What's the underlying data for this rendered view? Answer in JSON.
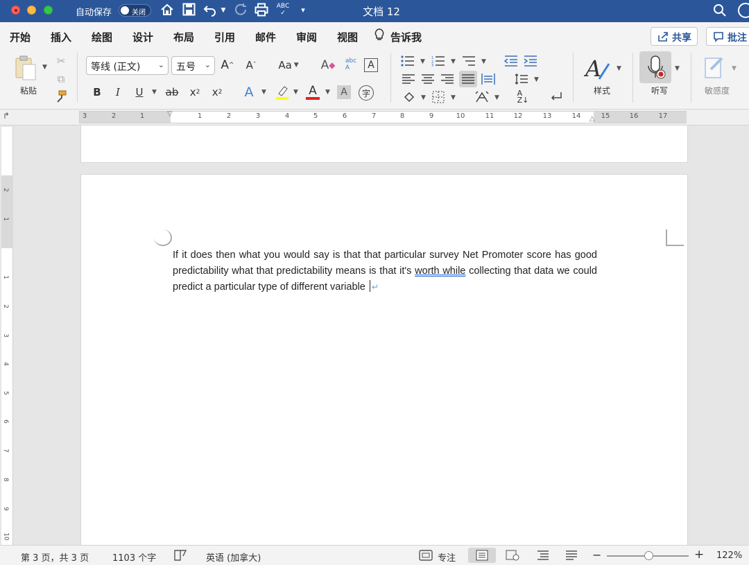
{
  "titlebar": {
    "autosave_label": "自动保存",
    "autosave_state": "关闭",
    "document_title": "文档 12"
  },
  "tabs": [
    {
      "label": "开始",
      "active": true
    },
    {
      "label": "插入"
    },
    {
      "label": "绘图"
    },
    {
      "label": "设计"
    },
    {
      "label": "布局"
    },
    {
      "label": "引用"
    },
    {
      "label": "邮件"
    },
    {
      "label": "审阅"
    },
    {
      "label": "视图"
    },
    {
      "label": "告诉我"
    }
  ],
  "header_buttons": {
    "share": "共享",
    "comments": "批注"
  },
  "ribbon": {
    "paste_label": "粘贴",
    "font_name": "等线 (正文)",
    "font_size": "五号",
    "change_case": "Aa",
    "styles_label": "样式",
    "dictate_label": "听写",
    "sensitivity_label": "敏感度",
    "bold": "B",
    "italic": "I",
    "underline": "U",
    "strikethrough": "ab",
    "subscript": "x",
    "superscript": "x"
  },
  "ruler": {
    "ticks": [
      "3",
      "2",
      "1",
      "1",
      "2",
      "3",
      "4",
      "5",
      "6",
      "7",
      "8",
      "9",
      "10",
      "11",
      "12",
      "13",
      "14",
      "15",
      "16",
      "17"
    ]
  },
  "vruler": {
    "ticks": [
      "2",
      "1",
      "1",
      "2",
      "3",
      "4",
      "5",
      "6",
      "7",
      "8",
      "9",
      "10"
    ]
  },
  "document": {
    "text_before": "If it does then what you would say is that that particular survey Net Promoter score has good predictability what that predictability means is that it's ",
    "underlined": "worth while",
    "text_after": " collecting that data we could predict a particular type of different variable"
  },
  "status": {
    "page": "第 3 页，共 3 页",
    "words": "1103 个字",
    "language": "英语 (加拿大)",
    "focus": "专注",
    "zoom": "122%"
  },
  "colors": {
    "titlebar_bg": "#2b579a",
    "highlight": "#ffff00",
    "font_color": "#e02020",
    "accent": "#2b579a"
  }
}
